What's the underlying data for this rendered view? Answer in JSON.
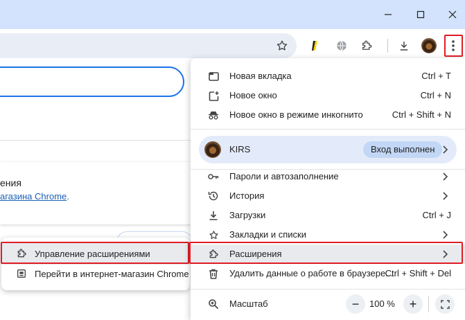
{
  "page": {
    "card_heading": "ения",
    "card_link_text": "агазина Chrome",
    "card_link_suffix": "."
  },
  "menu": {
    "items_top": [
      {
        "label": "Новая вкладка",
        "shortcut": "Ctrl + T",
        "icon": "new-tab-icon"
      },
      {
        "label": "Новое окно",
        "shortcut": "Ctrl + N",
        "icon": "new-window-icon"
      },
      {
        "label": "Новое окно в режиме инкогнито",
        "shortcut": "Ctrl + Shift + N",
        "icon": "incognito-icon"
      }
    ],
    "profile": {
      "name": "KIRS",
      "status": "Вход выполнен"
    },
    "items_mid": [
      {
        "label": "Пароли и автозаполнение",
        "icon": "key-icon"
      },
      {
        "label": "История",
        "icon": "history-icon"
      },
      {
        "label": "Загрузки",
        "shortcut": "Ctrl + J",
        "icon": "download-icon"
      },
      {
        "label": "Закладки и списки",
        "icon": "star-icon"
      },
      {
        "label": "Расширения",
        "icon": "puzzle-icon"
      },
      {
        "label": "Удалить данные о работе в браузере...",
        "shortcut": "Ctrl + Shift + Del",
        "icon": "trash-icon"
      }
    ],
    "zoom": {
      "label": "Масштаб",
      "value": "100 %",
      "minus": "−",
      "plus": "+"
    }
  },
  "submenu": {
    "items": [
      {
        "label": "Управление расширениями",
        "icon": "puzzle-icon"
      },
      {
        "label": "Перейти в интернет-магазин Chrome",
        "icon": "store-icon"
      }
    ]
  },
  "colors": {
    "titlebar": "#d3e3fd",
    "highlight_outline": "#e01b24",
    "profile_bg": "#e3ebfa"
  }
}
